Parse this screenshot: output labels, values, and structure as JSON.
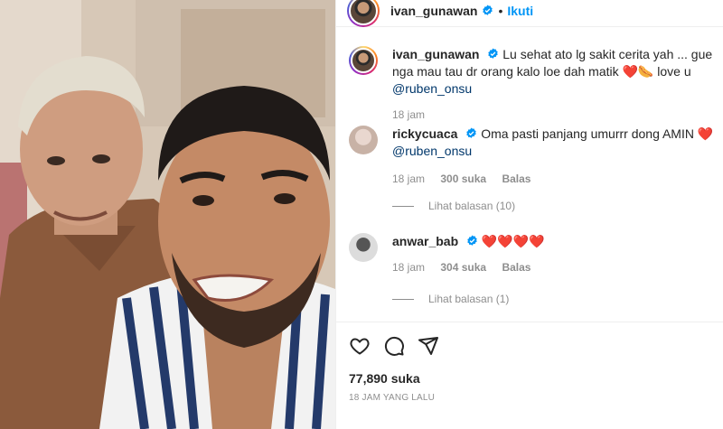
{
  "post": {
    "username": "ivan_gunawan",
    "follow_label": "Ikuti",
    "separator": "•"
  },
  "caption": {
    "username": "ivan_gunawan",
    "text": "Lu sehat ato lg sakit cerita yah ... gue nga mau tau dr orang kalo loe dah matik",
    "emoji": "❤️🌭",
    "love": " love u ",
    "mention": "@ruben_onsu",
    "time": "18 jam"
  },
  "comments": [
    {
      "username": "rickycuaca",
      "text": "Oma pasti panjang umurrr dong AMIN",
      "emoji": "❤️",
      "mention": "@ruben_onsu",
      "time": "18 jam",
      "likes": "300 suka",
      "reply": "Balas",
      "view_replies": "Lihat balasan (10)"
    },
    {
      "username": "anwar_bab",
      "text": "",
      "emoji": "❤️❤️❤️❤️",
      "time": "18 jam",
      "likes": "304 suka",
      "reply": "Balas",
      "view_replies": "Lihat balasan (1)"
    }
  ],
  "footer": {
    "likes": "77,890 suka",
    "time_ago": "18 JAM YANG LALU"
  },
  "icons": [
    "verified-icon",
    "heart-icon",
    "comment-icon",
    "share-icon"
  ],
  "colors": {
    "accent": "#0095f6",
    "heart": "#ed4956",
    "mention": "#00376b",
    "muted": "#8e8e8e"
  }
}
